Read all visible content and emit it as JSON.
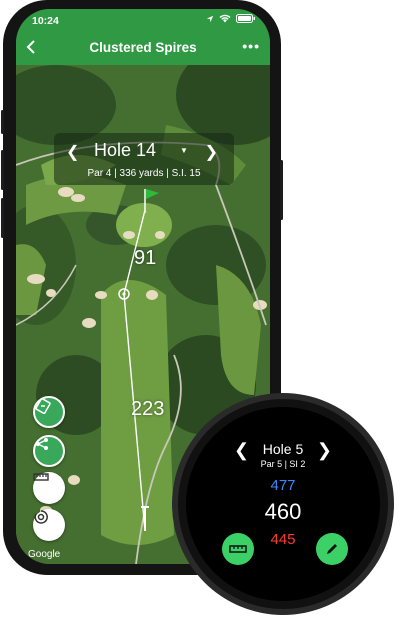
{
  "status_bar": {
    "time": "10:24"
  },
  "app_bar": {
    "title": "Clustered Spires"
  },
  "hole_card": {
    "hole": "Hole 14",
    "info": "Par 4  |  336 yards  |  S.I. 15"
  },
  "map": {
    "distances": [
      "91",
      "223"
    ],
    "attribution": "Google"
  },
  "watch": {
    "hole": "Hole 5",
    "info": "Par 5  |  SI 2",
    "back": "477",
    "middle": "460",
    "front": "445"
  },
  "colors": {
    "brand_green": "#2f9a43",
    "watch_back": "#3f86ff",
    "watch_front": "#ff3b30",
    "watch_button": "#3cd167"
  }
}
